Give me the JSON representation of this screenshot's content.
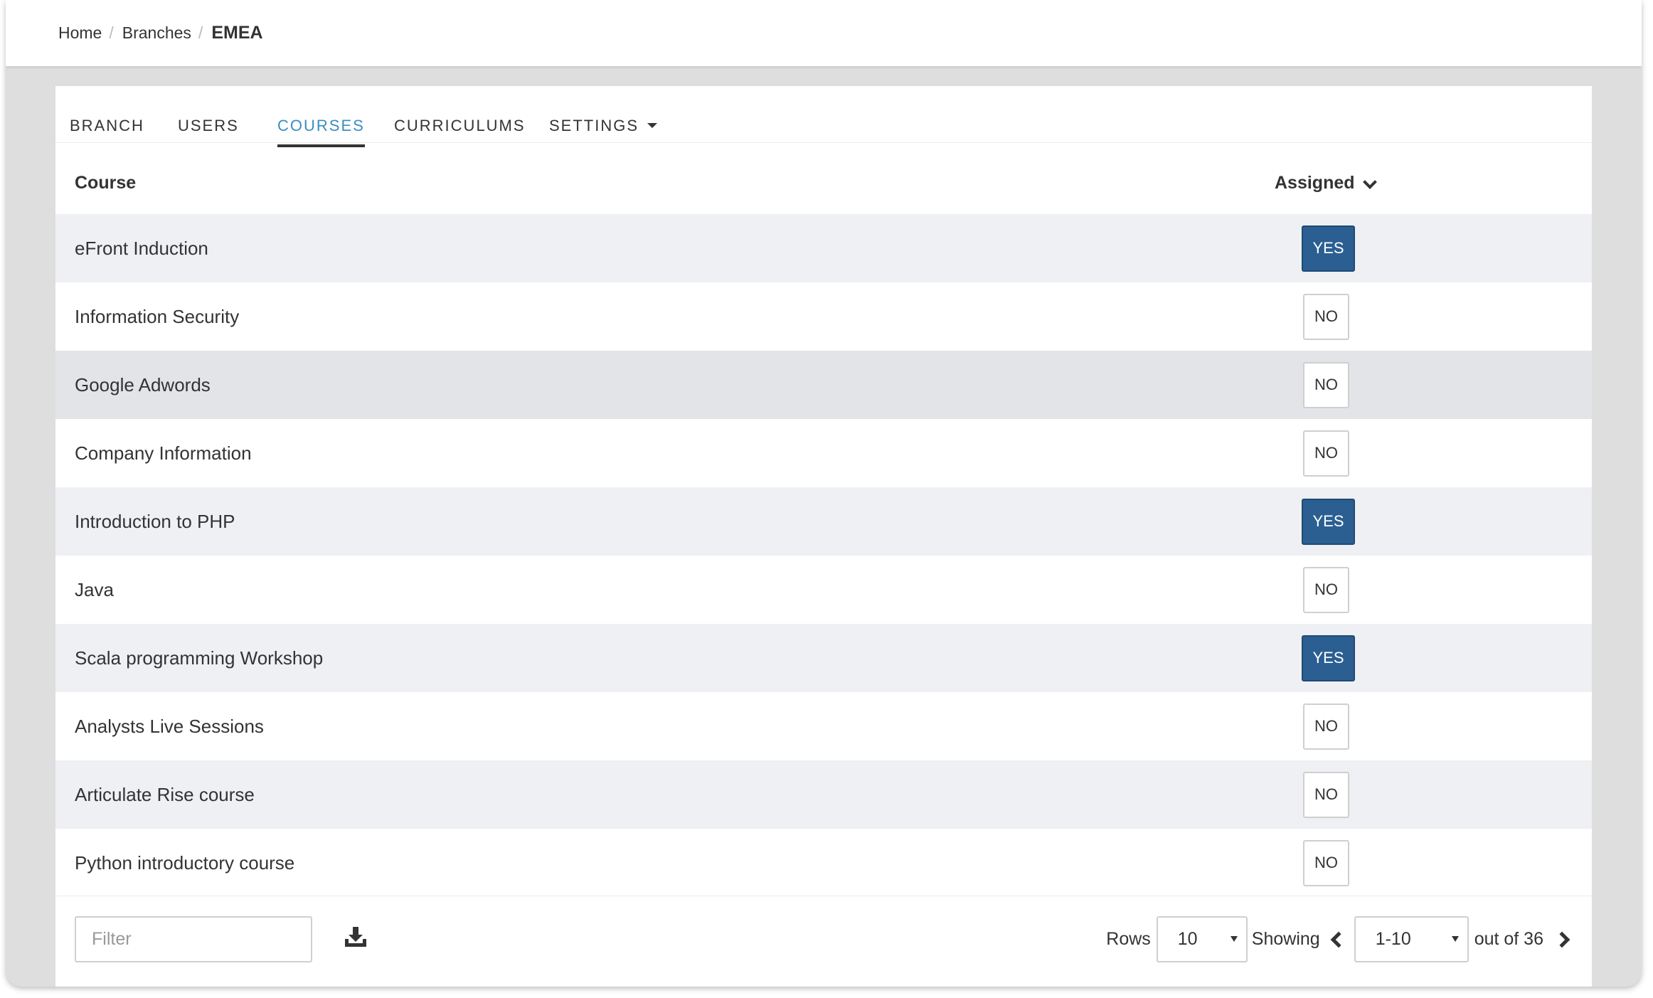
{
  "breadcrumb": {
    "home": "Home",
    "branches": "Branches",
    "current": "EMEA"
  },
  "tabs": [
    {
      "label": "BRANCH"
    },
    {
      "label": "USERS"
    },
    {
      "label": "COURSES"
    },
    {
      "label": "CURRICULUMS"
    },
    {
      "label": "SETTINGS"
    }
  ],
  "table": {
    "col_course": "Course",
    "col_assigned": "Assigned",
    "rows": [
      {
        "course": "eFront Induction",
        "assigned": "YES"
      },
      {
        "course": "Information Security",
        "assigned": "NO"
      },
      {
        "course": "Google Adwords",
        "assigned": "NO"
      },
      {
        "course": "Company Information",
        "assigned": "NO"
      },
      {
        "course": "Introduction to PHP",
        "assigned": "YES"
      },
      {
        "course": "Java",
        "assigned": "NO"
      },
      {
        "course": "Scala programming Workshop",
        "assigned": "YES"
      },
      {
        "course": "Analysts Live Sessions",
        "assigned": "NO"
      },
      {
        "course": "Articulate Rise course",
        "assigned": "NO"
      },
      {
        "course": "Python introductory course",
        "assigned": "NO"
      }
    ]
  },
  "footer": {
    "filter_placeholder": "Filter",
    "rows_label": "Rows",
    "rows_value": "10",
    "showing_label": "Showing",
    "range_value": "1-10",
    "total_label": "out of 36"
  },
  "colors": {
    "accent": "#3a8ec0",
    "yes_bg": "#2b5f92"
  },
  "icons": {
    "download": "download-icon",
    "sort": "chevron-down-icon",
    "prev": "chevron-left-icon",
    "next": "chevron-right-icon"
  }
}
